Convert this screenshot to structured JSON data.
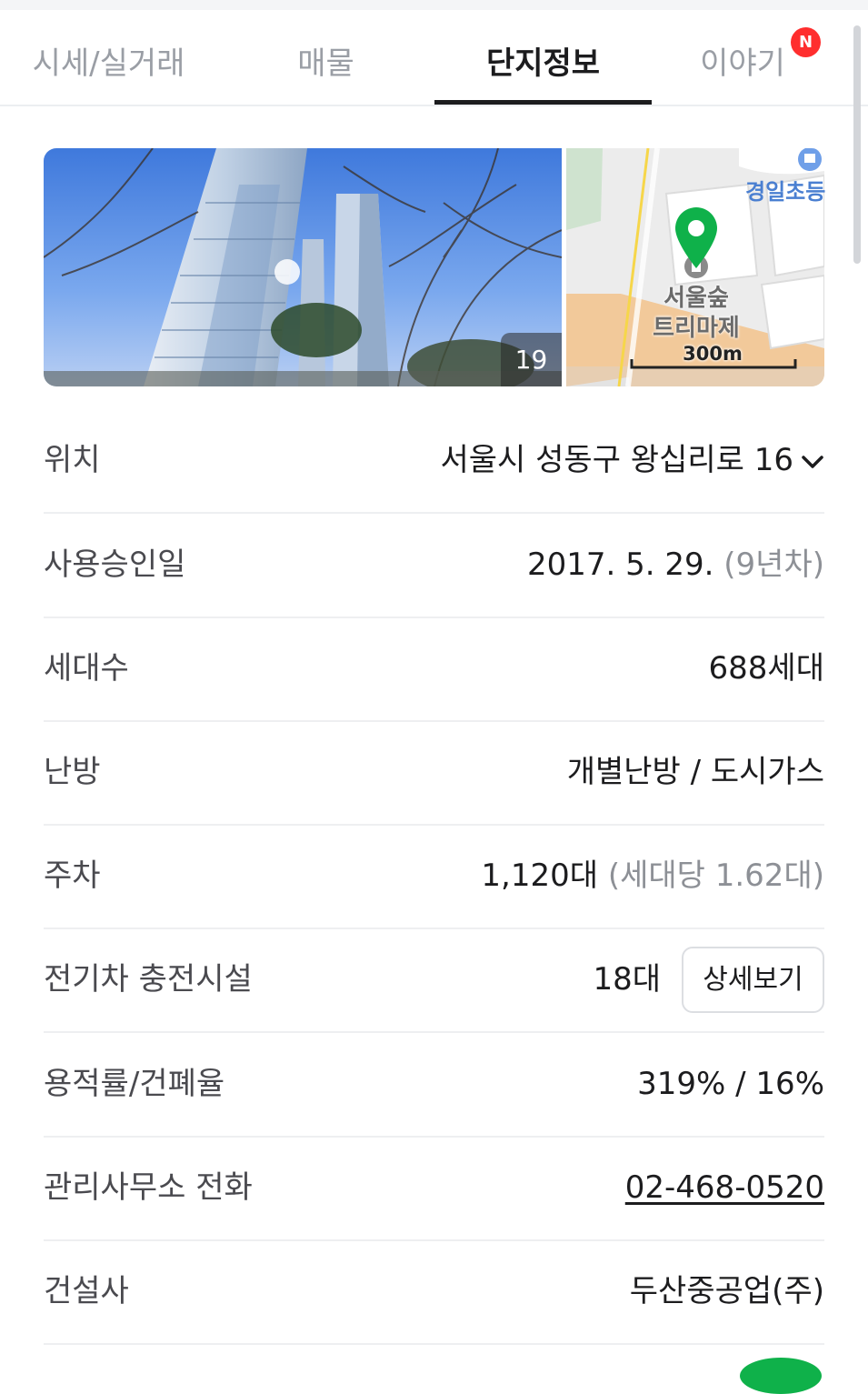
{
  "tabs": [
    {
      "label": "시세/실거래",
      "active": false
    },
    {
      "label": "매물",
      "active": false
    },
    {
      "label": "단지정보",
      "active": true
    },
    {
      "label": "이야기",
      "active": false,
      "badge": "N"
    }
  ],
  "gallery": {
    "photo_count": "19",
    "map": {
      "school_label": "경일초등",
      "place_label_line1": "서울숲",
      "place_label_line2": "트리마제",
      "scale_label": "300m"
    }
  },
  "info": {
    "location": {
      "label": "위치",
      "value": "서울시 성동구 왕십리로 16"
    },
    "approval": {
      "label": "사용승인일",
      "value": "2017. 5. 29.",
      "sub": "(9년차)"
    },
    "households": {
      "label": "세대수",
      "value": "688세대"
    },
    "heating": {
      "label": "난방",
      "value": "개별난방 / 도시가스"
    },
    "parking": {
      "label": "주차",
      "value": "1,120대",
      "sub": "(세대당 1.62대)"
    },
    "ev": {
      "label": "전기차 충전시설",
      "value": "18대",
      "button": "상세보기"
    },
    "ratio": {
      "label": "용적률/건폐율",
      "value": "319% / 16%"
    },
    "office": {
      "label": "관리사무소 전화",
      "value": "02-468-0520"
    },
    "builder": {
      "label": "건설사",
      "value": "두산중공업(주)"
    }
  },
  "colors": {
    "accent_green": "#0fb14a",
    "badge_red": "#ff2e2e",
    "text_dark": "#1c1c1e",
    "text_muted": "#8d9096"
  }
}
